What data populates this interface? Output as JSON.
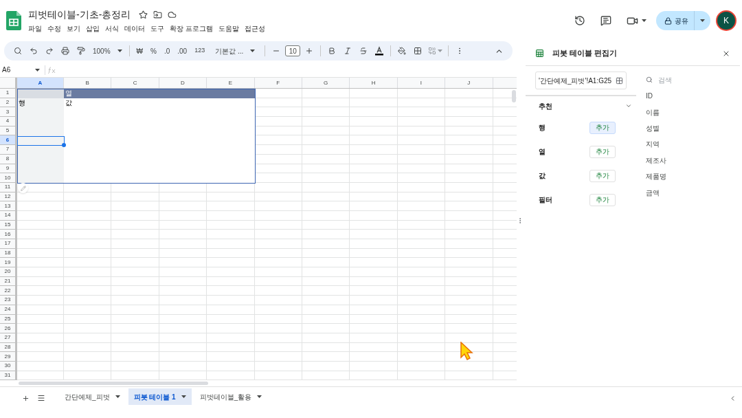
{
  "document": {
    "title": "피벗테이블-기초-총정리",
    "menu": [
      "파일",
      "수정",
      "보기",
      "삽입",
      "서식",
      "데이터",
      "도구",
      "확장 프로그램",
      "도움말",
      "접근성"
    ]
  },
  "header": {
    "share": "공유",
    "avatar": "K"
  },
  "toolbar": {
    "zoom": "100%",
    "currency": "₩",
    "percent": "%",
    "decrease_decimal": ".0",
    "increase_decimal": ".00",
    "number_format": "123",
    "font": "기본값 ...",
    "font_size": "10"
  },
  "name_box": "A6",
  "grid": {
    "columns": [
      "A",
      "B",
      "C",
      "D",
      "E",
      "F",
      "G",
      "H",
      "I",
      "J"
    ],
    "rows": [
      {
        "label": "1",
        "cells": [
          null,
          {
            "text": "열",
            "kind": "header"
          }
        ]
      },
      {
        "label": "2",
        "cells": [
          {
            "text": "행",
            "kind": "value"
          },
          {
            "text": "값",
            "kind": "value"
          }
        ]
      },
      {
        "label": "3"
      },
      {
        "label": "4"
      },
      {
        "label": "5"
      },
      {
        "label": "6"
      },
      {
        "label": "7"
      },
      {
        "label": "8"
      },
      {
        "label": "9"
      },
      {
        "label": "10"
      },
      {
        "label": "11"
      },
      {
        "label": "12"
      },
      {
        "label": "13"
      },
      {
        "label": "14"
      },
      {
        "label": "15"
      },
      {
        "label": "16"
      },
      {
        "label": "17"
      },
      {
        "label": "18"
      },
      {
        "label": "19"
      },
      {
        "label": "20"
      },
      {
        "label": "21"
      },
      {
        "label": "22"
      },
      {
        "label": "23"
      },
      {
        "label": "24"
      },
      {
        "label": "25"
      },
      {
        "label": "26"
      },
      {
        "label": "27"
      },
      {
        "label": "28"
      },
      {
        "label": "29"
      },
      {
        "label": "30"
      },
      {
        "label": "31"
      }
    ]
  },
  "sheet_tabs": [
    {
      "label": "간단예제_피벗",
      "selected": false
    },
    {
      "label": "피봇 테이블 1",
      "selected": true
    },
    {
      "label": "피벗테이블_활용",
      "selected": false
    }
  ],
  "pivot_editor": {
    "title": "피봇 테이블 편집기",
    "range": "'간단예제_피벗'!A1:G25",
    "suggested": {
      "label": "추천",
      "expanded": false
    },
    "sections": [
      {
        "label": "행",
        "button": "추가",
        "highlighted": true
      },
      {
        "label": "열",
        "button": "추가",
        "highlighted": false
      },
      {
        "label": "값",
        "button": "추가",
        "highlighted": false
      },
      {
        "label": "필터",
        "button": "추가",
        "highlighted": false
      }
    ],
    "search": {
      "placeholder": "검색"
    },
    "fields": [
      "ID",
      "이름",
      "성별",
      "지역",
      "제조사",
      "제품명",
      "금액"
    ]
  }
}
